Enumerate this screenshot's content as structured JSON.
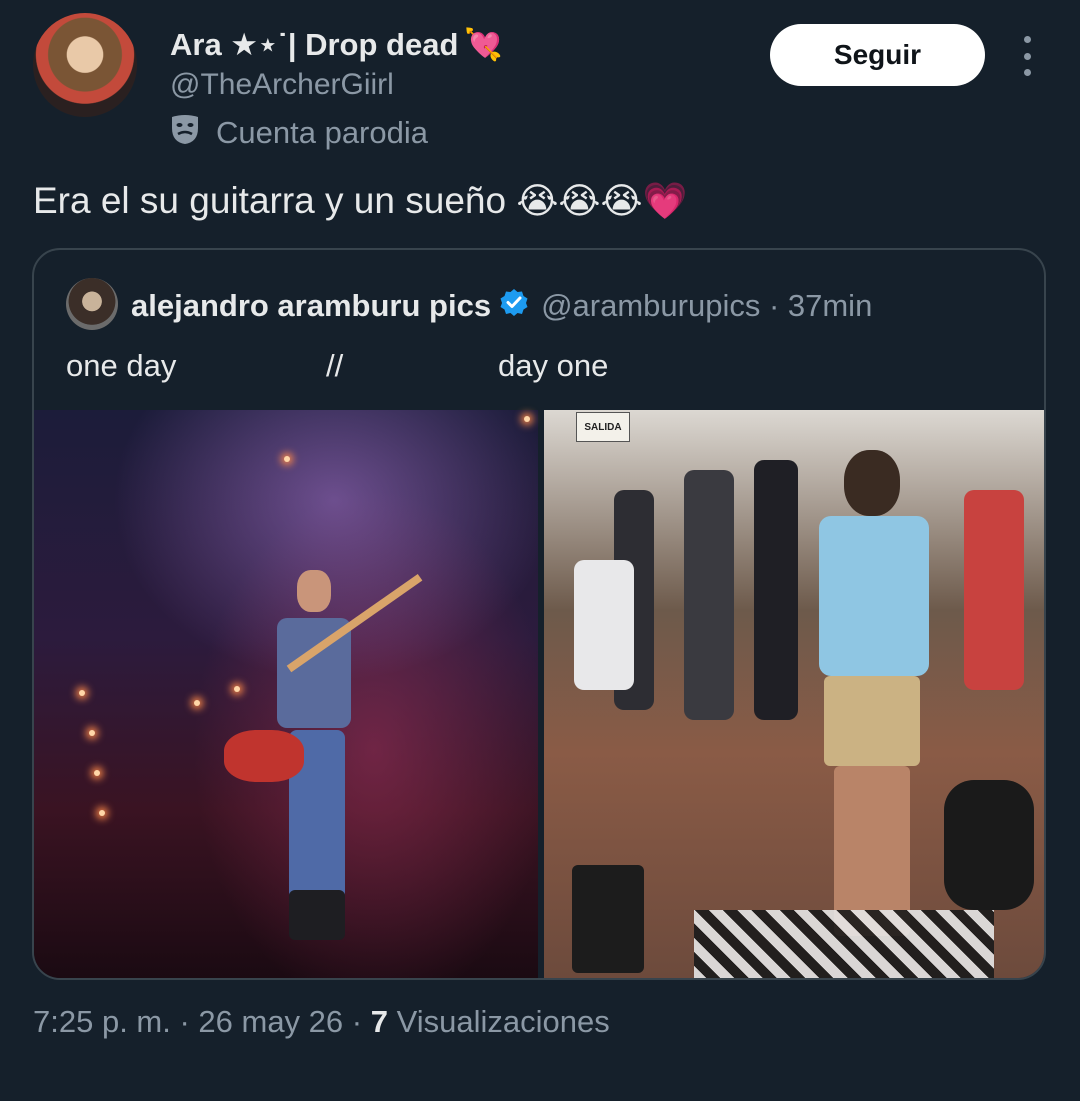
{
  "tweet": {
    "display_name": "Ara ★⋆˙| Drop dead",
    "display_name_emoji": "💘",
    "handle": "@TheArcherGiirl",
    "parody_label": "Cuenta parodia",
    "follow_label": "Seguir",
    "text": "Era el su guitarra y un sueño",
    "text_emojis": "😭😭😭💗",
    "timestamp": "7:25 p. m. · 26 may 26 ·",
    "views_count": "7",
    "views_label": "Visualizaciones"
  },
  "quote": {
    "name": "alejandro aramburu pics",
    "handle": "@aramburupics · 37min",
    "text_left": "one day",
    "text_middle": "//",
    "text_right": "day one",
    "sign_text": "SALIDA"
  },
  "colors": {
    "background": "#15202b",
    "text_primary": "#e7e9ea",
    "text_secondary": "#8b98a5",
    "verified": "#1d9bf0",
    "border": "#38444d"
  },
  "icons": {
    "parody": "theater-mask-icon",
    "verified": "verified-badge-icon",
    "more": "more-options-icon"
  }
}
